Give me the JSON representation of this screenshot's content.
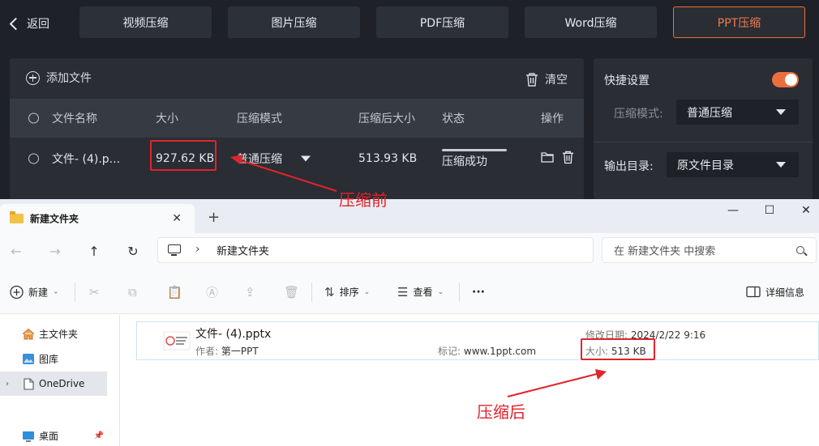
{
  "app": {
    "back_label": "返回",
    "tabs": [
      {
        "label": "视频压缩",
        "active": false
      },
      {
        "label": "图片压缩",
        "active": false
      },
      {
        "label": "PDF压缩",
        "active": false
      },
      {
        "label": "Word压缩",
        "active": false
      },
      {
        "label": "PPT压缩",
        "active": true
      }
    ],
    "add_file_label": "添加文件",
    "clear_label": "清空",
    "table": {
      "headers": [
        "文件名称",
        "大小",
        "压缩模式",
        "压缩后大小",
        "状态",
        "操作"
      ],
      "row": {
        "name": "文件- (4).p...",
        "size": "927.62 KB",
        "mode": "普通压缩",
        "compressed_size": "513.93 KB",
        "status": "压缩成功",
        "progress": 1.0
      }
    },
    "settings": {
      "title": "快捷设置",
      "toggle_on": true,
      "mode_label": "压缩模式:",
      "mode_value": "普通压缩",
      "output_label": "输出目录:",
      "output_value": "原文件目录"
    },
    "accent_color": "#ec6e3f"
  },
  "annotations": {
    "before": "压缩前",
    "after": "压缩后",
    "color": "#e0242c"
  },
  "explorer": {
    "tab_title": "新建文件夹",
    "new_tab_symbol": "+",
    "window_controls": {
      "minimize": "—",
      "maximize": "☐",
      "close": "✕"
    },
    "breadcrumb": "新建文件夹",
    "search_placeholder": "在 新建文件夹 中搜索",
    "toolbar": {
      "new_label": "新建",
      "sort_label": "排序",
      "view_label": "查看",
      "more_label": "···",
      "details_label": "详细信息"
    },
    "sidebar": [
      {
        "label": "主文件夹",
        "icon": "home-icon"
      },
      {
        "label": "图库",
        "icon": "gallery-icon"
      },
      {
        "label": "OneDrive",
        "icon": "onedrive-icon"
      },
      {
        "label": "桌面",
        "icon": "desktop-icon"
      }
    ],
    "file": {
      "name": "文件- (4).pptx",
      "author_key": "作者:",
      "author": "第一PPT",
      "tag_key": "标记:",
      "tag": "www.1ppt.com",
      "modified_key": "修改日期:",
      "modified": "2024/2/22 9:16",
      "size_key": "大小:",
      "size": "513 KB"
    }
  }
}
